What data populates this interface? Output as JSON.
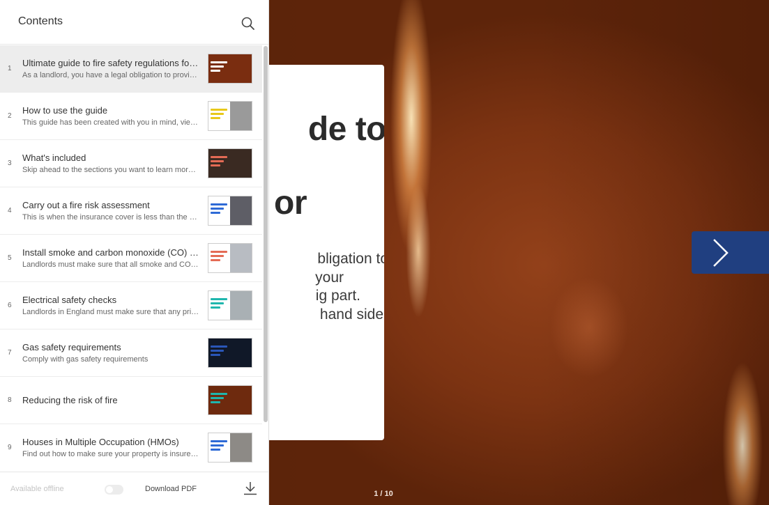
{
  "sidebar": {
    "title": "Contents",
    "footer": {
      "offline_label": "Available offline",
      "download_label": "Download PDF"
    },
    "items": [
      {
        "num": "1",
        "title": "Ultimate guide to fire safety regulations for landlords",
        "desc": "As a landlord, you have a legal obligation to provide a safe property",
        "thumb": "#7a2d10",
        "bar": "#ffffff",
        "active": true
      },
      {
        "num": "2",
        "title": "How to use the guide",
        "desc": "This guide has been created with you in mind, view it as a whole",
        "thumb": "#9a9a9a",
        "bar": "#e8c81a"
      },
      {
        "num": "3",
        "title": "What's included",
        "desc": "Skip ahead to the sections you want to learn more about",
        "thumb": "#3a2a22",
        "bar": "#e46b55"
      },
      {
        "num": "4",
        "title": "Carry out a fire risk assessment",
        "desc": "This is when the insurance cover is less than the actual value",
        "thumb": "#5e5e66",
        "bar": "#2e6ad6"
      },
      {
        "num": "5",
        "title": "Install smoke and carbon monoxide (CO) alarms",
        "desc": "Landlords must make sure that all smoke and CO alarms work",
        "thumb": "#b8bcc2",
        "bar": "#e46b55"
      },
      {
        "num": "6",
        "title": "Electrical safety checks",
        "desc": "Landlords in England must make sure that any private tenancy",
        "thumb": "#a9b0b4",
        "bar": "#1fb6ad"
      },
      {
        "num": "7",
        "title": "Gas safety requirements",
        "desc": "Comply with gas safety requirements",
        "thumb": "#101828",
        "bar": "#2a56b8"
      },
      {
        "num": "8",
        "title": "Reducing the risk of fire",
        "desc": "",
        "thumb": "#6e2a0e",
        "bar": "#1fb6ad"
      },
      {
        "num": "9",
        "title": "Houses in Multiple Occupation (HMOs)",
        "desc": "Find out how to make sure your property is insured correctly",
        "thumb": "#8d8a86",
        "bar": "#2e6ad6"
      }
    ]
  },
  "page": {
    "title_lines": [
      "de to",
      "or"
    ],
    "body_lines": [
      "bligation to",
      "your",
      "ig part.",
      "hand side"
    ],
    "indicator": "1 / 10"
  }
}
